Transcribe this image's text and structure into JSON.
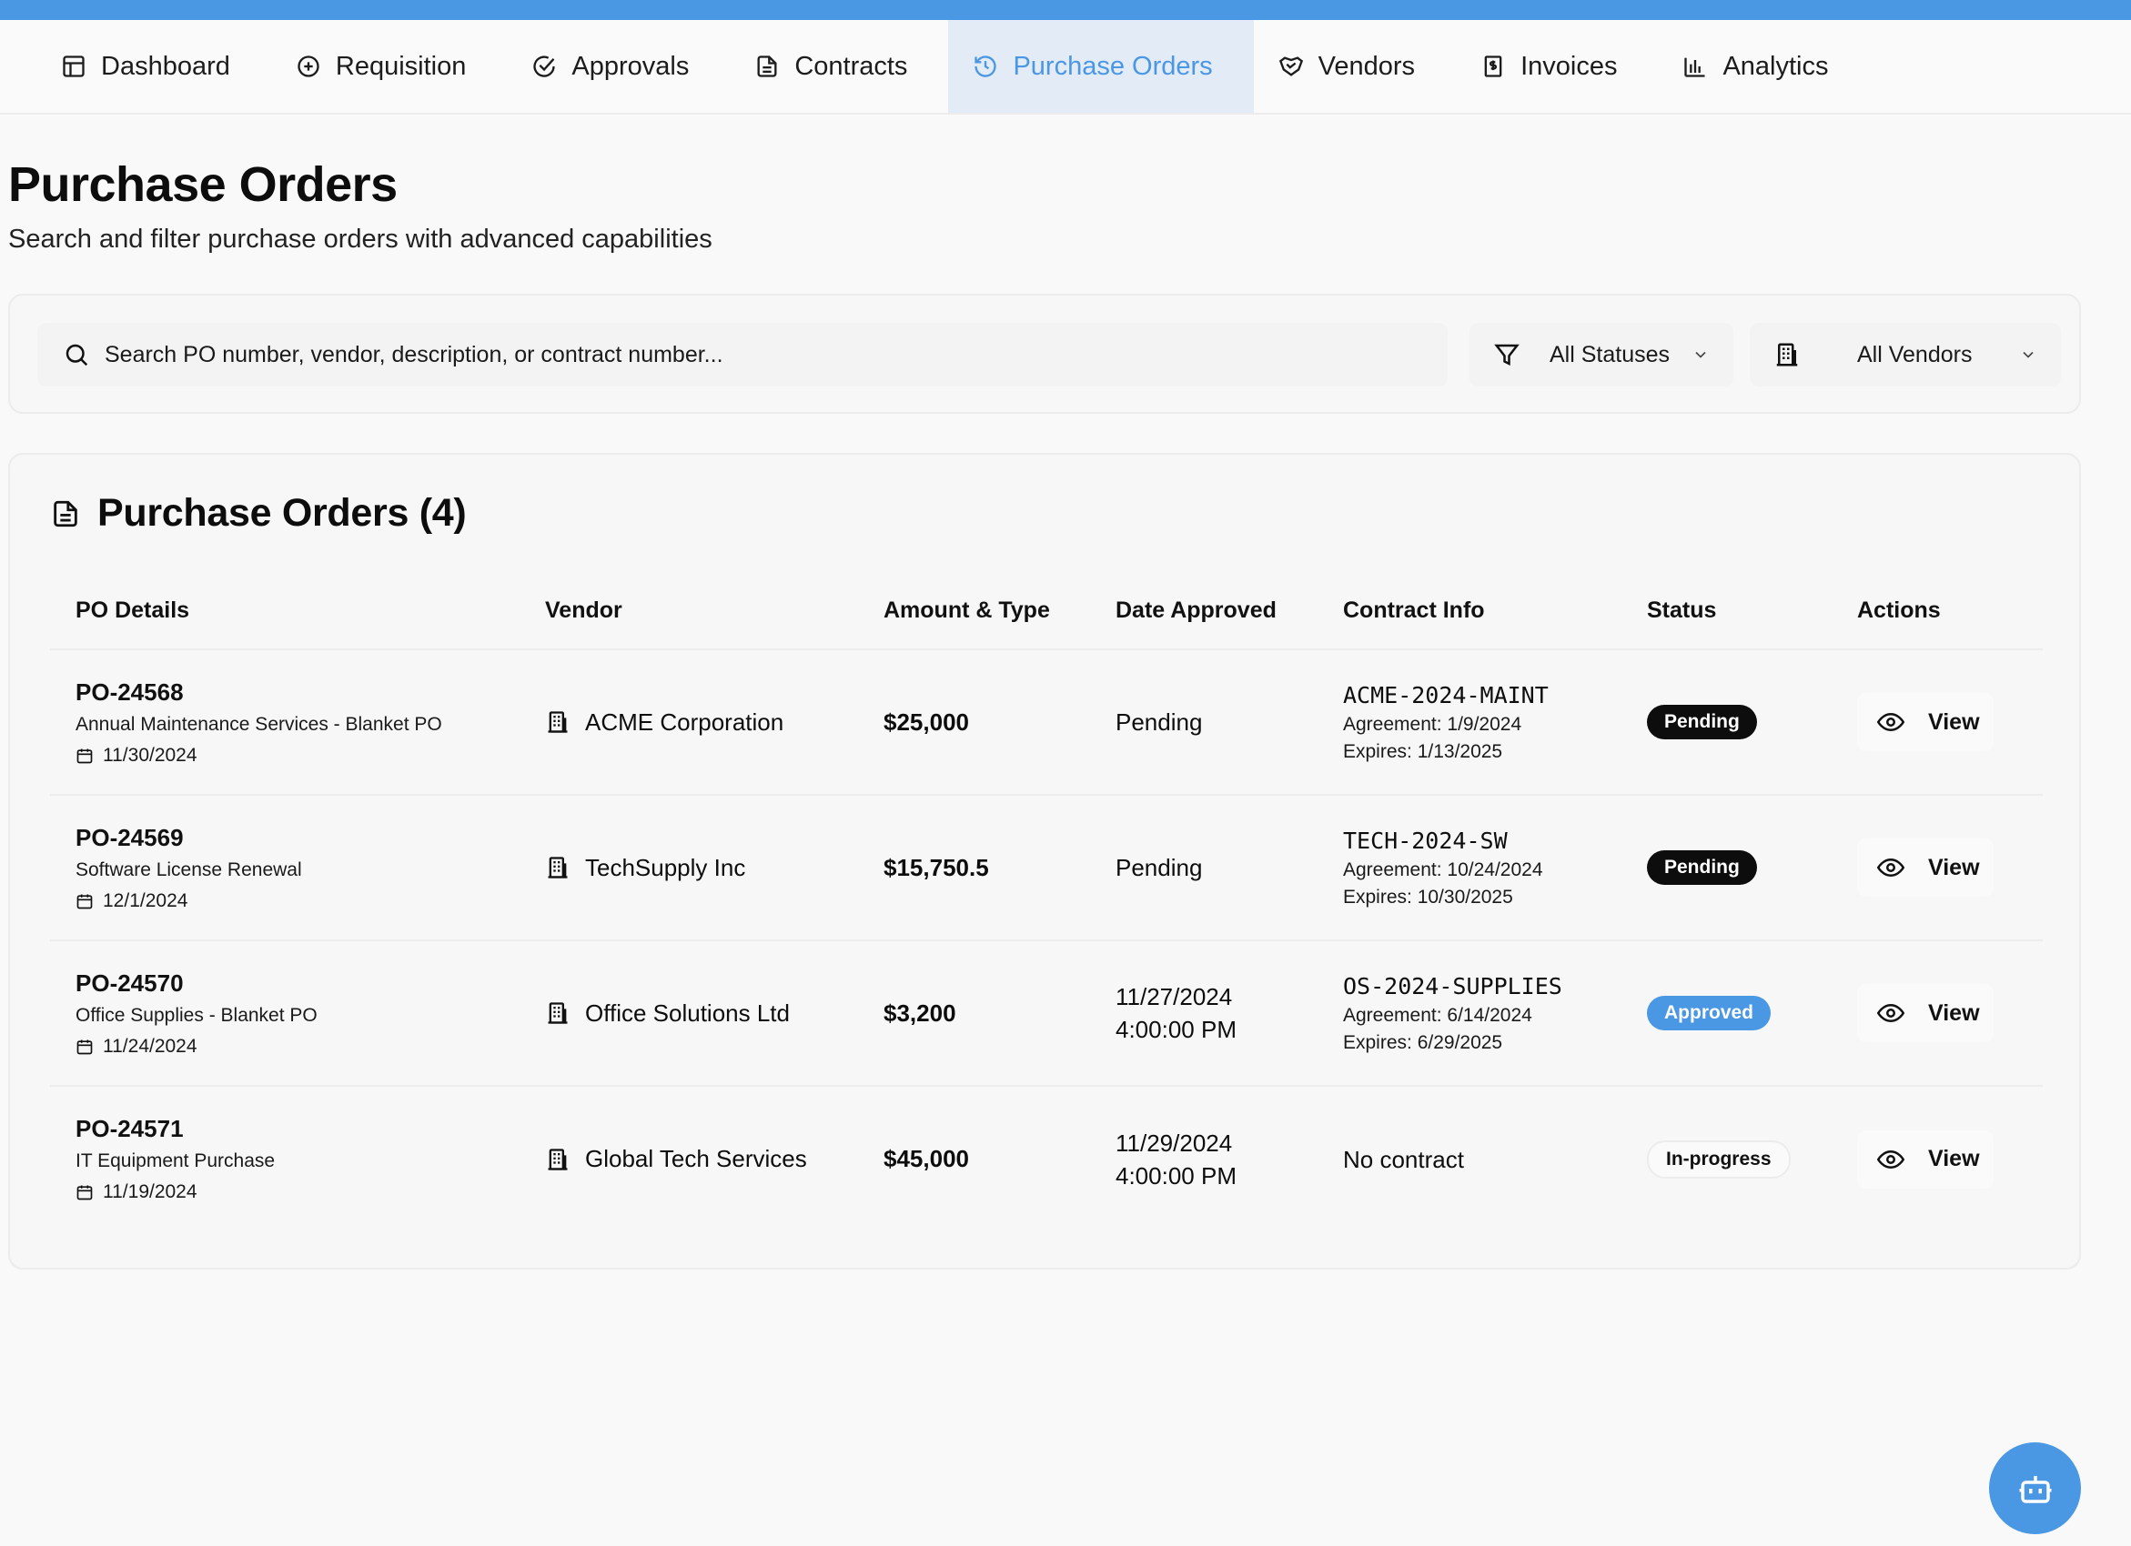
{
  "nav": {
    "tabs": [
      {
        "label": "Dashboard",
        "icon": "layout-icon"
      },
      {
        "label": "Requisition",
        "icon": "plus-circle-icon"
      },
      {
        "label": "Approvals",
        "icon": "check-circle-icon"
      },
      {
        "label": "Contracts",
        "icon": "file-text-icon"
      },
      {
        "label": "Purchase Orders",
        "icon": "history-icon",
        "active": true
      },
      {
        "label": "Vendors",
        "icon": "handshake-icon"
      },
      {
        "label": "Invoices",
        "icon": "receipt-icon"
      },
      {
        "label": "Analytics",
        "icon": "bar-chart-icon"
      }
    ]
  },
  "page": {
    "title": "Purchase Orders",
    "subtitle": "Search and filter purchase orders with advanced capabilities"
  },
  "filters": {
    "search_placeholder": "Search PO number, vendor, description, or contract number...",
    "status_value": "All Statuses",
    "vendor_value": "All Vendors"
  },
  "table": {
    "title": "Purchase Orders (4)",
    "headers": [
      "PO Details",
      "Vendor",
      "Amount & Type",
      "Date Approved",
      "Contract Info",
      "Status",
      "Actions"
    ],
    "rows": [
      {
        "po_number": "PO-24568",
        "description": "Annual Maintenance Services - Blanket PO",
        "date": "11/30/2024",
        "vendor": "ACME Corporation",
        "amount": "$25,000",
        "date_approved_line1": "Pending",
        "date_approved_line2": "",
        "contract_number": "ACME-2024-MAINT",
        "agreement": "Agreement: 1/9/2024",
        "expires": "Expires: 1/13/2025",
        "no_contract": "",
        "status": "Pending",
        "action": "View"
      },
      {
        "po_number": "PO-24569",
        "description": "Software License Renewal",
        "date": "12/1/2024",
        "vendor": "TechSupply Inc",
        "amount": "$15,750.5",
        "date_approved_line1": "Pending",
        "date_approved_line2": "",
        "contract_number": "TECH-2024-SW",
        "agreement": "Agreement: 10/24/2024",
        "expires": "Expires: 10/30/2025",
        "no_contract": "",
        "status": "Pending",
        "action": "View"
      },
      {
        "po_number": "PO-24570",
        "description": "Office Supplies - Blanket PO",
        "date": "11/24/2024",
        "vendor": "Office Solutions Ltd",
        "amount": "$3,200",
        "date_approved_line1": "11/27/2024",
        "date_approved_line2": "4:00:00 PM",
        "contract_number": "OS-2024-SUPPLIES",
        "agreement": "Agreement: 6/14/2024",
        "expires": "Expires: 6/29/2025",
        "no_contract": "",
        "status": "Approved",
        "action": "View"
      },
      {
        "po_number": "PO-24571",
        "description": "IT Equipment Purchase",
        "date": "11/19/2024",
        "vendor": "Global Tech Services",
        "amount": "$45,000",
        "date_approved_line1": "11/29/2024",
        "date_approved_line2": "4:00:00 PM",
        "contract_number": "",
        "agreement": "",
        "expires": "",
        "no_contract": "No contract",
        "status": "In-progress",
        "action": "View"
      }
    ]
  },
  "colors": {
    "accent": "#4a97e4",
    "badge_pending": "#0d0d0d",
    "badge_approved": "#4a97e4",
    "active_tab_bg": "#e2ebf6"
  },
  "fab": {
    "icon": "bot-icon"
  }
}
